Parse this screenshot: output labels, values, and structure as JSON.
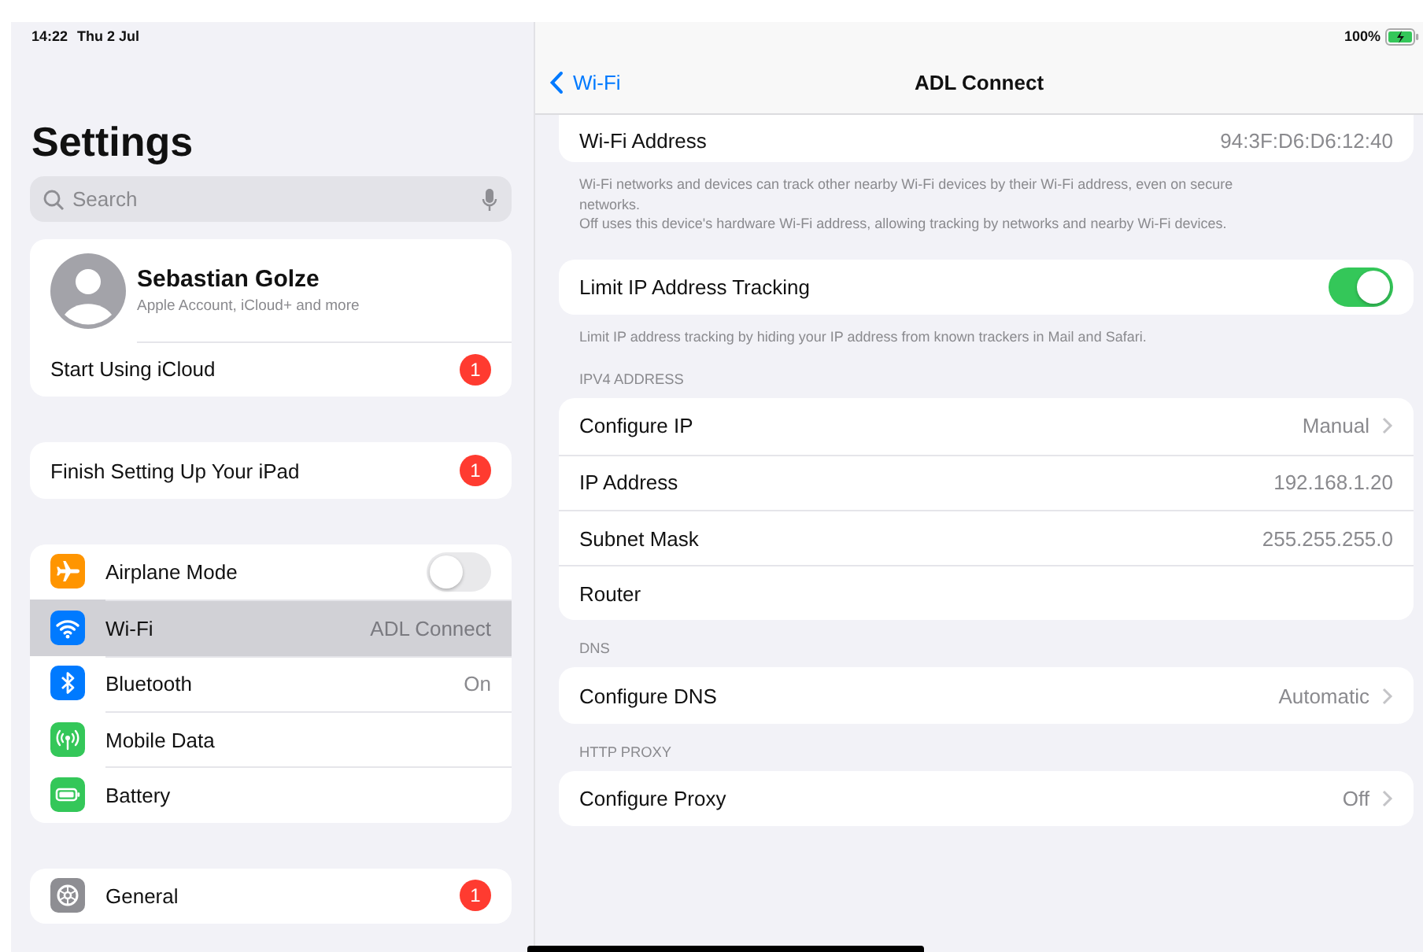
{
  "status_bar": {
    "time": "14:22",
    "date": "Thu 2 Jul",
    "battery": "100%"
  },
  "sidebar": {
    "title": "Settings",
    "search": {
      "placeholder": "Search"
    },
    "account": {
      "name": "Sebastian Golze",
      "subtitle": "Apple Account, iCloud+ and more"
    },
    "groups": [
      [
        {
          "label": "Start Using iCloud",
          "kind": "badge",
          "badge": "1",
          "selected": false
        }
      ],
      [
        {
          "label": "Finish Setting Up Your iPad",
          "kind": "badge",
          "badge": "1",
          "selected": false
        }
      ],
      [
        {
          "label": "Airplane Mode",
          "kind": "toggle",
          "on": false,
          "color": "#ff9500",
          "selected": false
        },
        {
          "label": "Wi-Fi",
          "kind": "value",
          "value": "ADL Connect",
          "color": "#007aff",
          "selected": true
        },
        {
          "label": "Bluetooth",
          "kind": "value",
          "value": "On",
          "color": "#007aff",
          "selected": false
        },
        {
          "label": "Mobile Data",
          "kind": "plain",
          "color": "#34c759",
          "selected": false
        },
        {
          "label": "Battery",
          "kind": "plain",
          "color": "#34c759",
          "selected": false
        }
      ],
      [
        {
          "label": "General",
          "kind": "badge",
          "badge": "1",
          "color": "#8e8e93",
          "selected": false
        }
      ]
    ]
  },
  "detail": {
    "back": "Wi-Fi",
    "title": "ADL Connect",
    "sections": [
      {
        "rows": [
          {
            "label": "Wi-Fi Address",
            "kind": "value",
            "value": "94:3F:D6:D6:12:40"
          }
        ],
        "footer": [
          "Wi-Fi networks and devices can track other nearby Wi-Fi devices by their Wi-Fi address, even on secure networks.",
          "Off uses this device's hardware Wi-Fi address, allowing tracking by networks and nearby Wi-Fi devices."
        ]
      },
      {
        "rows": [
          {
            "label": "Limit IP Address Tracking",
            "kind": "toggle",
            "on": true
          }
        ],
        "footer": [
          "Limit IP address tracking by hiding your IP address from known trackers in Mail and Safari."
        ]
      },
      {
        "header": "IPV4 ADDRESS",
        "rows": [
          {
            "label": "Configure IP",
            "kind": "chevron",
            "value": "Manual"
          },
          {
            "label": "IP Address",
            "kind": "value",
            "value": "192.168.1.20"
          },
          {
            "label": "Subnet Mask",
            "kind": "value",
            "value": "255.255.255.0"
          },
          {
            "label": "Router",
            "kind": "plain"
          }
        ]
      },
      {
        "header": "DNS",
        "rows": [
          {
            "label": "Configure DNS",
            "kind": "chevron",
            "value": "Automatic"
          }
        ]
      },
      {
        "header": "HTTP PROXY",
        "rows": [
          {
            "label": "Configure Proxy",
            "kind": "chevron",
            "value": "Off"
          }
        ]
      }
    ]
  }
}
